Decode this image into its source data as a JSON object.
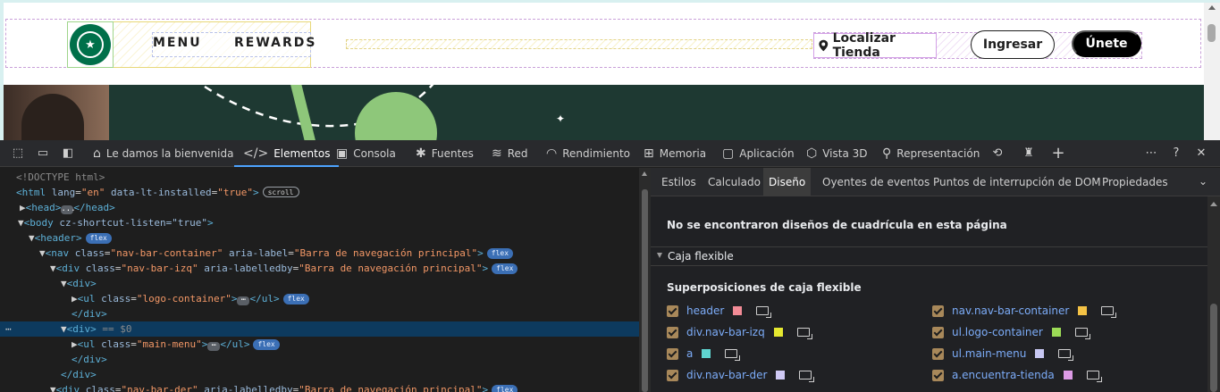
{
  "site": {
    "logo_alt": "Starbucks",
    "menu": [
      "MENU",
      "REWARDS"
    ],
    "store_link": "Localizar Tienda",
    "login": "Ingresar",
    "join": "Únete"
  },
  "devtools": {
    "toolbar_tabs": [
      {
        "label": "Le damos la bienvenida",
        "icon": "home-icon"
      },
      {
        "label": "Elementos",
        "icon": "code-icon",
        "active": true
      },
      {
        "label": "Consola",
        "icon": "console-icon"
      },
      {
        "label": "Fuentes",
        "icon": "bug-icon"
      },
      {
        "label": "Red",
        "icon": "wifi-icon"
      },
      {
        "label": "Rendimiento",
        "icon": "gauge-icon"
      },
      {
        "label": "Memoria",
        "icon": "chip-icon"
      },
      {
        "label": "Aplicación",
        "icon": "app-icon"
      },
      {
        "label": "Vista 3D",
        "icon": "cube-icon"
      },
      {
        "label": "Representación",
        "icon": "brush-icon"
      }
    ],
    "dom_tree": {
      "doctype": "<!DOCTYPE html>",
      "html_open": {
        "lang": "en",
        "data_lt_installed": "true",
        "badge": "scroll"
      },
      "head": {
        "badge": "..."
      },
      "body": {
        "attr": "cz-shortcut-listen=\"true\""
      },
      "header": {
        "badge": "flex"
      },
      "nav": {
        "class": "nav-bar-container",
        "aria_label": "Barra de navegación principal",
        "badge": "flex"
      },
      "div_izq": {
        "class": "nav-bar-izq",
        "aria_labelledby": "Barra de navegación principal",
        "badge": "flex"
      },
      "ul_logo": {
        "class": "logo-container",
        "badge": "flex"
      },
      "selected_marker": "== $0",
      "ul_menu": {
        "class": "main-menu",
        "badge": "flex"
      },
      "div_der": {
        "class": "nav-bar-der",
        "aria_labelledby": "Barra de navegación principal",
        "badge": "flex"
      }
    },
    "side_tabs": [
      "Estilos",
      "Calculado",
      "Diseño",
      "Oyentes de eventos",
      "Puntos de interrupción de DOM",
      "Propiedades"
    ],
    "side_active": "Diseño",
    "no_grid": "No se encontraron diseños de cuadrícula en esta página",
    "flex_section": "Caja flexible",
    "overlays_title": "Superposiciones de caja flexible",
    "overlays": [
      {
        "label": "header",
        "color": "#f28b96"
      },
      {
        "label": "nav.nav-bar-container",
        "color": "#f4c245"
      },
      {
        "label": "div.nav-bar-izq",
        "color": "#e5e830"
      },
      {
        "label": "ul.logo-container",
        "color": "#9cdb56"
      },
      {
        "label": "a",
        "color": "#5fd5d0"
      },
      {
        "label": "ul.main-menu",
        "color": "#c7c7f2"
      },
      {
        "label": "div.nav-bar-der",
        "color": "#cfc9f4"
      },
      {
        "label": "a.encuentra-tienda",
        "color": "#dd9be6"
      }
    ]
  }
}
